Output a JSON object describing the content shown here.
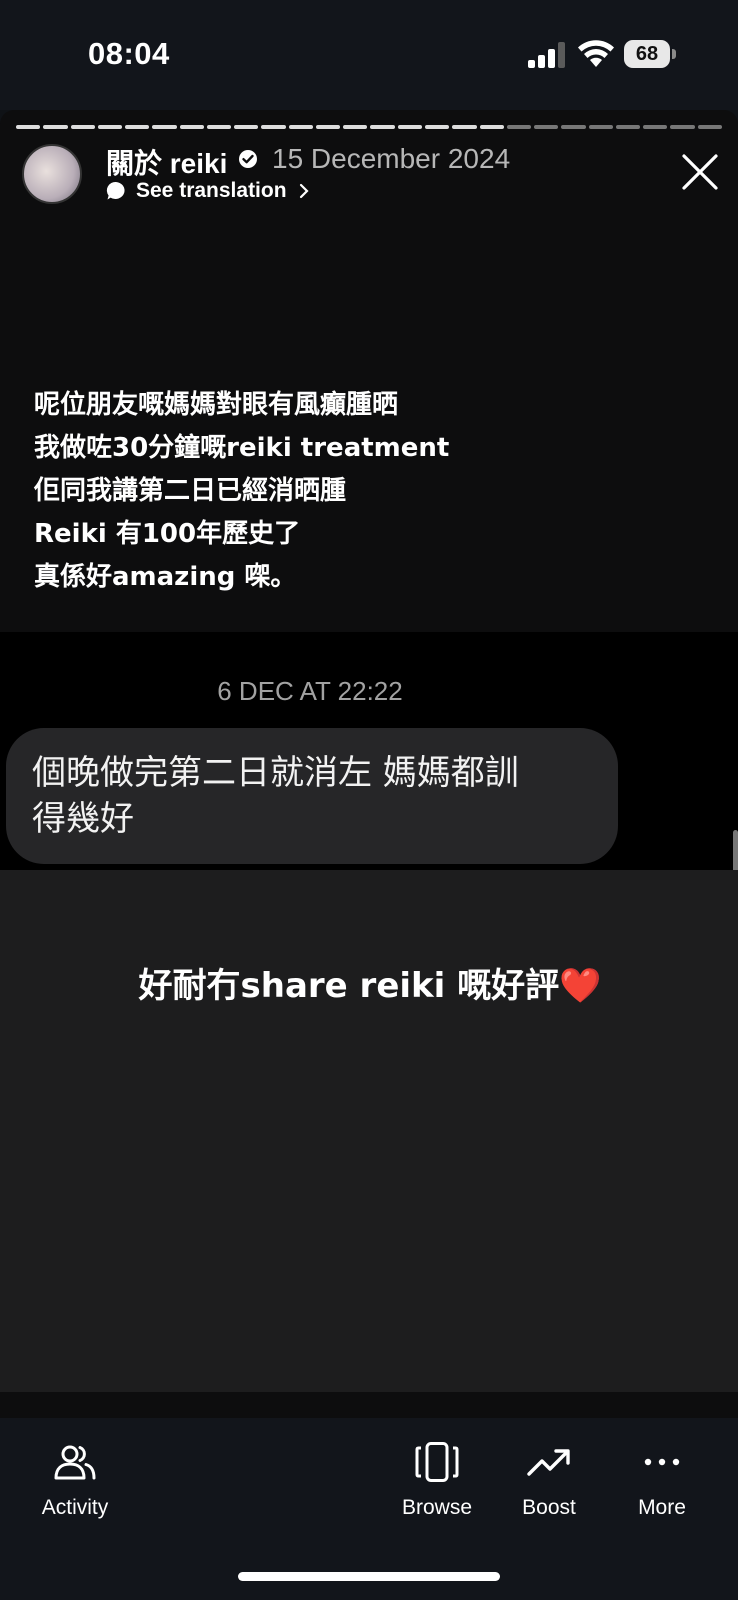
{
  "status_bar": {
    "time": "08:04",
    "battery_level": "68",
    "icons": [
      "cellular-signal-icon",
      "wifi-icon",
      "battery-icon"
    ]
  },
  "story": {
    "progress_segments": 26,
    "progress_completed": 18,
    "username": "關於 reiki",
    "date": "15 December 2024",
    "see_translation": "See translation",
    "caption_lines": [
      "呢位朋友嘅媽媽對眼有風癲腫晒",
      "我做咗30分鐘嘅reiki treatment",
      "佢同我講第二日已經消晒腫",
      "Reiki 有100年歷史了",
      "真係好amazing 㗎。"
    ],
    "chat": {
      "timestamp": "6 DEC AT 22:22",
      "message_line1": "個晚做完第二日就消左 媽媽都訓",
      "message_line2": "得幾好"
    },
    "sticker_text": "好耐冇share reiki 嘅好評",
    "sticker_emoji": "❤️"
  },
  "bottom_nav": {
    "activity": "Activity",
    "browse": "Browse",
    "boost": "Boost",
    "more": "More"
  },
  "colors": {
    "background": "#0f1216",
    "story_background": "#0d0d0e",
    "bubble": "#262628",
    "sticker_background": "#1d1d1e",
    "heart": "#e01b2f"
  }
}
